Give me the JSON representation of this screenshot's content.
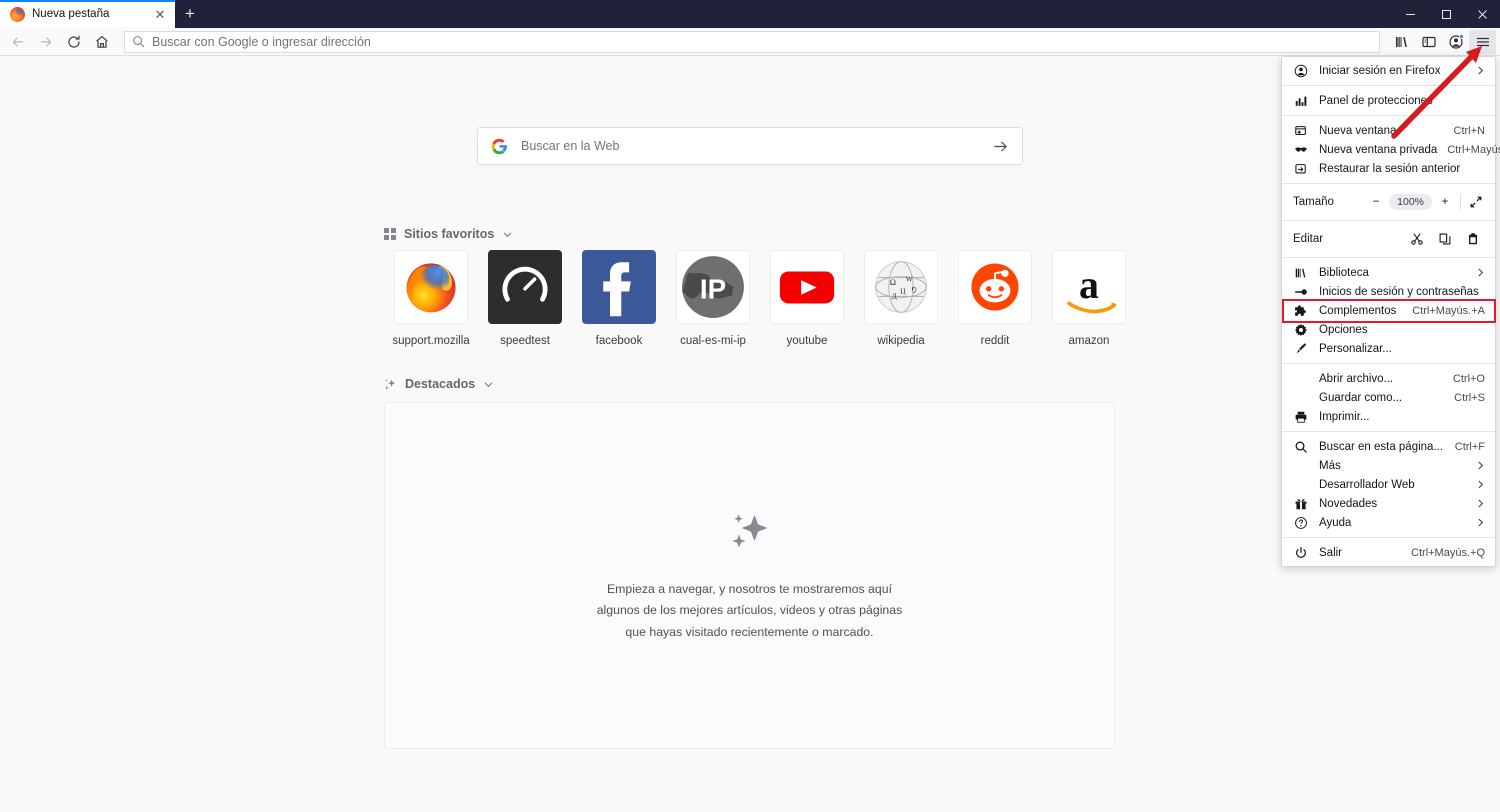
{
  "window": {
    "controls": {
      "minimize": "–",
      "maximize": "▢",
      "close": "✕"
    }
  },
  "tabstrip": {
    "tabs": [
      {
        "title": "Nueva pestaña",
        "favicon": "firefox-icon",
        "close": "✕"
      }
    ],
    "new_tab_label": "+"
  },
  "navbar": {
    "back_icon": "back-arrow-icon",
    "forward_icon": "forward-arrow-icon",
    "reload_icon": "reload-icon",
    "home_icon": "home-icon",
    "urlbar_placeholder": "Buscar con Google o ingresar dirección",
    "urlbar_value": "",
    "toolbar_icons": [
      "library-icon",
      "sidebar-icon",
      "account-icon",
      "hamburger-menu-icon"
    ]
  },
  "newtab": {
    "search": {
      "engine": "google",
      "placeholder": "Buscar en la Web",
      "go_icon": "arrow-right-icon"
    },
    "topsites": {
      "heading": "Sitios favoritos",
      "icon": "grid-icon",
      "caret": "chevron-down-icon",
      "items": [
        {
          "label": "support.mozilla",
          "icon": "firefox-logo"
        },
        {
          "label": "speedtest",
          "icon": "speedtest-gauge"
        },
        {
          "label": "facebook",
          "icon": "facebook-f"
        },
        {
          "label": "cual-es-mi-ip",
          "icon": "ip-globe"
        },
        {
          "label": "youtube",
          "icon": "youtube-play"
        },
        {
          "label": "wikipedia",
          "icon": "wikipedia-globe"
        },
        {
          "label": "reddit",
          "icon": "reddit-alien"
        },
        {
          "label": "amazon",
          "icon": "amazon-a"
        }
      ]
    },
    "highlights": {
      "heading": "Destacados",
      "icon": "sparkle-icon",
      "caret": "chevron-down-icon",
      "empty_icon": "sparkle-large-icon",
      "empty_lines": [
        "Empieza a navegar, y nosotros te mostraremos aquí",
        "algunos de los mejores artículos, videos y otras páginas",
        "que hayas visitado recientemente o marcado."
      ]
    }
  },
  "app_menu": {
    "groups": [
      {
        "items": [
          {
            "label": "Iniciar sesión en Firefox",
            "icon": "account-circle-icon",
            "shortcut": "",
            "chevron": "›"
          }
        ]
      },
      {
        "items": [
          {
            "label": "Panel de protecciones",
            "icon": "protections-chart-icon",
            "shortcut": "",
            "chevron": ""
          }
        ]
      },
      {
        "items": [
          {
            "label": "Nueva ventana",
            "icon": "new-window-icon",
            "shortcut": "Ctrl+N",
            "chevron": ""
          },
          {
            "label": "Nueva ventana privada",
            "icon": "private-mask-icon",
            "shortcut": "Ctrl+Mayús.+P",
            "chevron": ""
          },
          {
            "label": "Restaurar la sesión anterior",
            "icon": "restore-session-icon",
            "shortcut": "",
            "chevron": ""
          }
        ]
      },
      {
        "zoom": {
          "label": "Tamaño",
          "minus": "−",
          "value": "100%",
          "plus": "+",
          "fullscreen_icon": "fullscreen-icon"
        }
      },
      {
        "edit": {
          "label": "Editar",
          "cut_icon": "cut-scissors-icon",
          "copy_icon": "copy-icon",
          "paste_icon": "paste-clipboard-icon"
        }
      },
      {
        "items": [
          {
            "label": "Biblioteca",
            "icon": "library-books-icon",
            "shortcut": "",
            "chevron": "›"
          },
          {
            "label": "Inicios de sesión y contraseñas",
            "icon": "key-icon",
            "shortcut": "",
            "chevron": ""
          },
          {
            "label": "Complementos",
            "icon": "puzzle-piece-icon",
            "shortcut": "Ctrl+Mayús.+A",
            "chevron": ""
          },
          {
            "label": "Opciones",
            "icon": "gear-icon",
            "shortcut": "",
            "chevron": "",
            "highlighted": true
          },
          {
            "label": "Personalizar...",
            "icon": "paintbrush-icon",
            "shortcut": "",
            "chevron": ""
          }
        ]
      },
      {
        "items": [
          {
            "label": "Abrir archivo...",
            "icon": "",
            "shortcut": "Ctrl+O",
            "chevron": ""
          },
          {
            "label": "Guardar como...",
            "icon": "",
            "shortcut": "Ctrl+S",
            "chevron": ""
          },
          {
            "label": "Imprimir...",
            "icon": "printer-icon",
            "shortcut": "",
            "chevron": ""
          }
        ]
      },
      {
        "items": [
          {
            "label": "Buscar en esta página...",
            "icon": "search-icon",
            "shortcut": "Ctrl+F",
            "chevron": ""
          },
          {
            "label": "Más",
            "icon": "",
            "shortcut": "",
            "chevron": "›"
          },
          {
            "label": "Desarrollador Web",
            "icon": "",
            "shortcut": "",
            "chevron": "›"
          },
          {
            "label": "Novedades",
            "icon": "gift-icon",
            "shortcut": "",
            "chevron": "›"
          },
          {
            "label": "Ayuda",
            "icon": "help-circle-icon",
            "shortcut": "",
            "chevron": "›"
          }
        ]
      },
      {
        "items": [
          {
            "label": "Salir",
            "icon": "power-icon",
            "shortcut": "Ctrl+Mayús.+Q",
            "chevron": ""
          }
        ]
      }
    ]
  },
  "annotations": {
    "highlight_color": "#e8192c",
    "arrow_color": "#d71920",
    "highlight_target": "Opciones",
    "arrow_target": "hamburger-menu-icon"
  },
  "colors": {
    "titlebar_bg": "#20223a",
    "tab_active_border": "#0a84ff",
    "chrome_bg": "#f9f9fa",
    "accent_blue": "#0a84ff"
  }
}
